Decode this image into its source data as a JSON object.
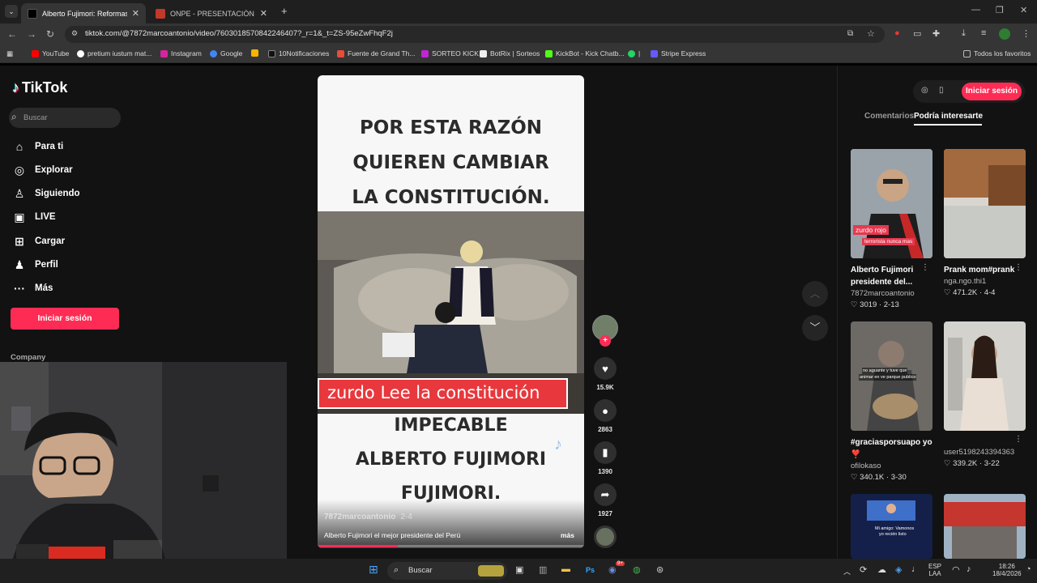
{
  "browser": {
    "tabs": [
      {
        "title": "Alberto Fujimori: Reformas y E",
        "active": true,
        "favicon_color": "#000000"
      },
      {
        "title": "ONPE - PRESENTACIÓN DE RES",
        "active": false,
        "favicon_color": "#c0392b"
      }
    ],
    "new_tab_symbol": "+",
    "url": "tiktok.com/@7872marcoantonio/video/7603018570842246407?_r=1&_t=ZS-95eZwFhqF2j",
    "bookmarks": [
      {
        "label": "YouTube",
        "color": "#ff0000"
      },
      {
        "label": "pretium iustum mat...",
        "color": "#ffffff"
      },
      {
        "label": "Instagram",
        "color": "#d6249f"
      },
      {
        "label": "Google",
        "color": "#4285f4"
      },
      {
        "label": "",
        "color": "#f4b400"
      },
      {
        "label": "10Notificaciones",
        "color": "#111111"
      },
      {
        "label": "Fuente de Grand Th...",
        "color": "#e74c3c"
      },
      {
        "label": "SORTEO KICK",
        "color": "#c026d3"
      },
      {
        "label": "BotRix | Sorteos",
        "color": "#eeeeee"
      },
      {
        "label": "KickBot - Kick Chatb...",
        "color": "#53fc18"
      },
      {
        "label": "|",
        "color": "#25d366"
      },
      {
        "label": "Stripe Express",
        "color": "#635bff"
      }
    ],
    "all_bookmarks": "Todos los favoritos"
  },
  "sidebar": {
    "brand": "TikTok",
    "search_placeholder": "Buscar",
    "nav": [
      {
        "label": "Para ti",
        "icon": "home-icon"
      },
      {
        "label": "Explorar",
        "icon": "compass-icon"
      },
      {
        "label": "Siguiendo",
        "icon": "following-icon"
      },
      {
        "label": "LIVE",
        "icon": "live-icon"
      },
      {
        "label": "Cargar",
        "icon": "upload-icon"
      },
      {
        "label": "Perfil",
        "icon": "profile-icon"
      },
      {
        "label": "Más",
        "icon": "more-icon"
      }
    ],
    "login": "Iniciar sesión",
    "company": "Company"
  },
  "video": {
    "top_text": [
      "POR ESTA RAZÓN",
      "QUIEREN CAMBIAR",
      "LA  CONSTITUCIÓN."
    ],
    "caption_band": "zurdo Lee la constitución",
    "bottom_text": [
      "IMPECABLE",
      "ALBERTO FUJIMORI",
      "FUJIMORI."
    ],
    "username": "7872marcoantonio",
    "date": "2-4",
    "description": "Alberto Fujimori el mejor presidente del Perú",
    "more": "más",
    "progress": 0.3
  },
  "actions": {
    "likes": "15.9K",
    "comments": "2863",
    "saves": "1390",
    "shares": "1927",
    "follow_plus": "+"
  },
  "right_panel": {
    "login": "Iniciar sesión",
    "tabs": [
      "Comentarios",
      "Podría interesarte"
    ],
    "cards": [
      {
        "title": "Alberto Fujimori presidente del...",
        "user": "7872marcoantonio",
        "likes": "3019",
        "date": "2-13",
        "overlay1": "zurdo rojo",
        "overlay2": "terrorista nunca mas"
      },
      {
        "title": "Prank mom#prank",
        "user": "nga.ngo.thi1",
        "likes": "471.2K",
        "date": "4-4"
      },
      {
        "title": "#graciasporsuapo yo ❣️",
        "user": "ofilokaso",
        "likes": "340.1K",
        "date": "3-30",
        "overlay1": "no aguante y tuve que",
        "overlay2": "animar en ve parque publico"
      },
      {
        "title": "",
        "user": "user5198243394363",
        "likes": "339.2K",
        "date": "3-22"
      },
      {
        "title": "",
        "user": "",
        "likes": "",
        "date": "",
        "overlay1": "Mi amigo: Vamonos",
        "overlay2": "yo recién listo"
      },
      {
        "title": "",
        "user": "",
        "likes": "",
        "date": ""
      }
    ]
  },
  "taskbar": {
    "search": "Buscar",
    "lang": "ESP",
    "lang2": "LAA",
    "time": "18:26",
    "date": "18/4/2026",
    "discord_badge": "9+"
  }
}
